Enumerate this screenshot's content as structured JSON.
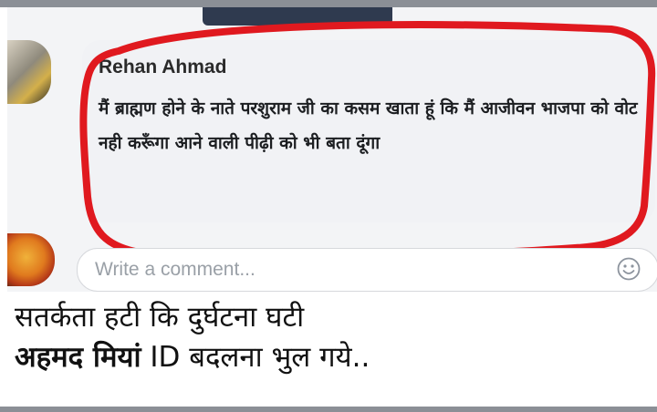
{
  "post": {
    "author": "Rehan Ahmad",
    "comment_text": "मैं ब्राह्मण होने के नाते परशुराम जी का कसम खाता हूं कि मैं आजीवन भाजपा को वोट नही करूँगा आने वाली पीढ़ी को भी बता दूंगा"
  },
  "composer": {
    "placeholder": "Write a comment..."
  },
  "caption": {
    "line1": "सतर्कता हटी कि दुर्घटना घटी",
    "line2_bold": "अहमद मियां",
    "line2_rest": " ID बदलना भुल गये.."
  },
  "icons": {
    "emoji": "smiley-icon"
  },
  "colors": {
    "highlight_oval": "#e0191f",
    "bubble": "#f1f2f5",
    "placeholder_text": "#9aa0a7"
  }
}
